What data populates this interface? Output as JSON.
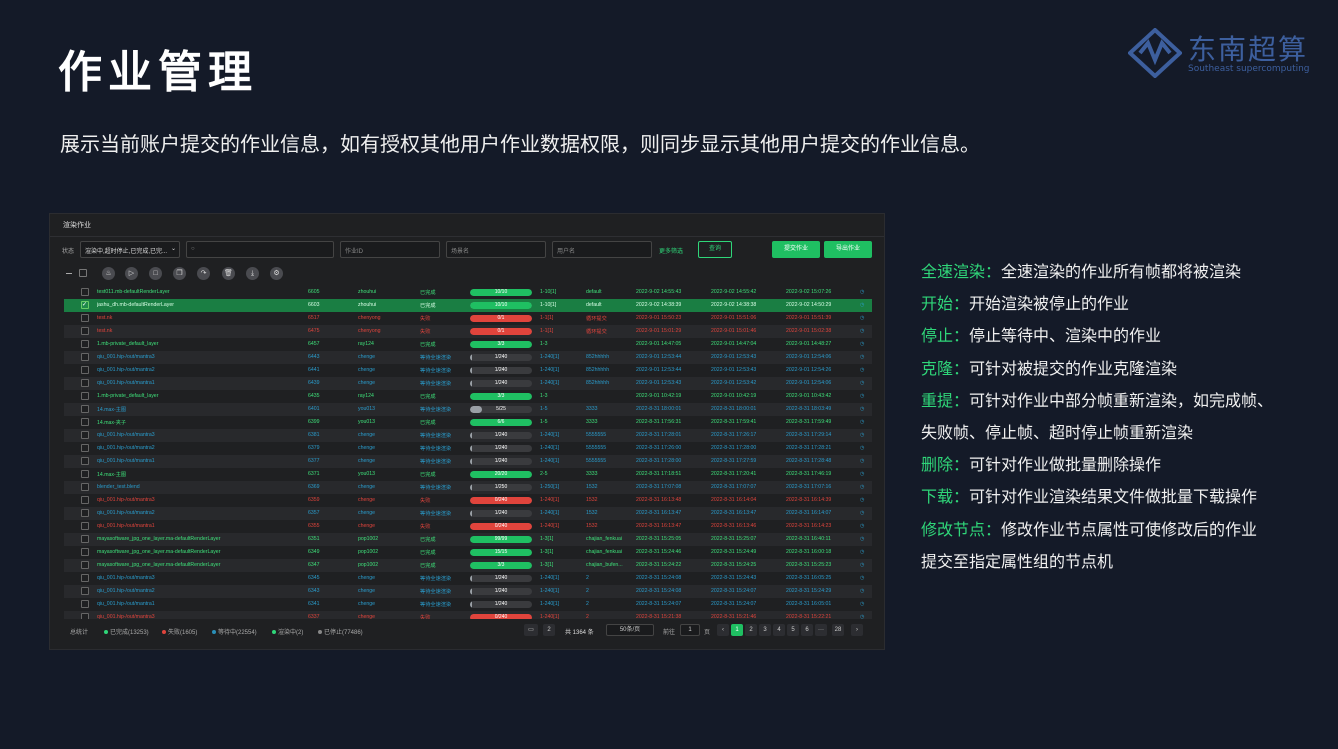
{
  "page_title": "作业管理",
  "subtitle": "展示当前账户提交的作业信息，如有授权其他用户作业数据权限，则同步显示其他用户提交的作业信息。",
  "logo": {
    "cn": "东南超算",
    "en": "Southeast supercomputing"
  },
  "colors": {
    "bg": "#141a28",
    "accent": "#2fd679",
    "success": "#1fbf62",
    "fail": "#e0443c",
    "waiting": "#2a8fb8",
    "logo": "#3d5f9e"
  },
  "app": {
    "title": "渲染作业",
    "filters": {
      "status_label": "状态",
      "status_value": "渲染中,超时停止,已完成,已完...",
      "search_placeholder": "",
      "job_id_placeholder": "作业ID",
      "scene_placeholder": "场景名",
      "user_placeholder": "用户名",
      "more_label": "更多筛选",
      "query_label": "查询",
      "submit_label": "提交作业",
      "export_label": "导出作业"
    },
    "toolbar_icons": [
      "start-icon",
      "play-icon",
      "stop-icon",
      "clone-icon",
      "resubmit-icon",
      "delete-icon",
      "download-icon",
      "settings-icon"
    ],
    "rows": [
      {
        "name": "test011.mb-defaultRenderLayer",
        "id": "6605",
        "user": "zhouhui",
        "status": "已完成",
        "progress": "10/10",
        "pct": 1.0,
        "frames": "1-10[1]",
        "group": "default",
        "submit": "2022-9-02 14:55:43",
        "start": "2022-9-02 14:55:42",
        "end": "2022-9-02 15:07:26",
        "kind": "done",
        "selected": false
      },
      {
        "name": "jashu_dh.mb-defaultRenderLayer",
        "id": "6603",
        "user": "zhouhui",
        "status": "已完成",
        "progress": "10/10",
        "pct": 1.0,
        "frames": "1-10[1]",
        "group": "default",
        "submit": "2022-9-02 14:38:39",
        "start": "2022-9-02 14:38:38",
        "end": "2022-9-02 14:50:29",
        "kind": "done",
        "selected": true
      },
      {
        "name": "test.nk",
        "id": "6517",
        "user": "chenyong",
        "status": "失败",
        "progress": "0/1",
        "pct": 1.0,
        "frames": "1-1[1]",
        "group": "循环提交",
        "submit": "2022-9-01 15:50:23",
        "start": "2022-9-01 15:51:06",
        "end": "2022-9-01 15:51:39",
        "kind": "fail",
        "selected": false
      },
      {
        "name": "test.nk",
        "id": "6475",
        "user": "chenyong",
        "status": "失败",
        "progress": "0/1",
        "pct": 1.0,
        "frames": "1-1[1]",
        "group": "循环提交",
        "submit": "2022-9-01 15:01:29",
        "start": "2022-9-01 15:01:46",
        "end": "2022-9-01 15:02:38",
        "kind": "fail",
        "selected": false
      },
      {
        "name": "1.mb-private_default_layer",
        "id": "6457",
        "user": "ray124",
        "status": "已完成",
        "progress": "3/3",
        "pct": 1.0,
        "frames": "1-3",
        "group": "",
        "submit": "2022-9-01 14:47:05",
        "start": "2022-9-01 14:47:04",
        "end": "2022-9-01 14:48:27",
        "kind": "done",
        "selected": false
      },
      {
        "name": "qiu_001.hip-/out/mantra3",
        "id": "6443",
        "user": "chenge",
        "status": "等待全速渲染",
        "progress": "1/240",
        "pct": 0.01,
        "frames": "1-240[1]",
        "group": "852hhhhh",
        "submit": "2022-9-01 12:53:44",
        "start": "2022-9-01 12:53:43",
        "end": "2022-9-01 12:54:06",
        "kind": "wait",
        "selected": false
      },
      {
        "name": "qiu_001.hip-/out/mantra2",
        "id": "6441",
        "user": "chenge",
        "status": "等待全速渲染",
        "progress": "1/240",
        "pct": 0.01,
        "frames": "1-240[1]",
        "group": "852hhhhh",
        "submit": "2022-9-01 12:53:44",
        "start": "2022-9-01 12:53:43",
        "end": "2022-9-01 12:54:26",
        "kind": "wait",
        "selected": false
      },
      {
        "name": "qiu_001.hip-/out/mantra1",
        "id": "6439",
        "user": "chenge",
        "status": "等待全速渲染",
        "progress": "1/240",
        "pct": 0.01,
        "frames": "1-240[1]",
        "group": "852hhhhh",
        "submit": "2022-9-01 12:53:43",
        "start": "2022-9-01 12:53:42",
        "end": "2022-9-01 12:54:06",
        "kind": "wait",
        "selected": false
      },
      {
        "name": "1.mb-private_default_layer",
        "id": "6435",
        "user": "ray124",
        "status": "已完成",
        "progress": "3/3",
        "pct": 1.0,
        "frames": "1-3",
        "group": "",
        "submit": "2022-9-01 10:42:19",
        "start": "2022-9-01 10:42:19",
        "end": "2022-9-01 10:43:42",
        "kind": "done",
        "selected": false
      },
      {
        "name": "14.max-主图",
        "id": "6401",
        "user": "you013",
        "status": "等待全速渲染",
        "progress": "5/25",
        "pct": 0.2,
        "frames": "1-5",
        "group": "3333",
        "submit": "2022-8-31 18:00:01",
        "start": "2022-8-31 18:00:01",
        "end": "2022-8-31 18:03:49",
        "kind": "wait",
        "selected": false
      },
      {
        "name": "14.max-夹子",
        "id": "6399",
        "user": "you013",
        "status": "已完成",
        "progress": "6/6",
        "pct": 1.0,
        "frames": "1-5",
        "group": "3333",
        "submit": "2022-8-31 17:56:31",
        "start": "2022-8-31 17:59:41",
        "end": "2022-8-31 17:59:49",
        "kind": "done",
        "selected": false
      },
      {
        "name": "qiu_001.hip-/out/mantra3",
        "id": "6381",
        "user": "chenge",
        "status": "等待全速渲染",
        "progress": "1/240",
        "pct": 0.01,
        "frames": "1-240[1]",
        "group": "5555555",
        "submit": "2022-8-31 17:28:01",
        "start": "2022-8-31 17:26:17",
        "end": "2022-8-31 17:29:14",
        "kind": "wait",
        "selected": false
      },
      {
        "name": "qiu_001.hip-/out/mantra2",
        "id": "6379",
        "user": "chenge",
        "status": "等待全速渲染",
        "progress": "1/240",
        "pct": 0.01,
        "frames": "1-240[1]",
        "group": "5555555",
        "submit": "2022-8-31 17:26:00",
        "start": "2022-8-31 17:28:00",
        "end": "2022-8-31 17:28:21",
        "kind": "wait",
        "selected": false
      },
      {
        "name": "qiu_001.hip-/out/mantra1",
        "id": "6377",
        "user": "chenge",
        "status": "等待全速渲染",
        "progress": "1/240",
        "pct": 0.01,
        "frames": "1-240[1]",
        "group": "5555555",
        "submit": "2022-8-31 17:28:00",
        "start": "2022-8-31 17:27:59",
        "end": "2022-8-31 17:28:48",
        "kind": "wait",
        "selected": false
      },
      {
        "name": "14.max-主图",
        "id": "6371",
        "user": "you013",
        "status": "已完成",
        "progress": "20/20",
        "pct": 1.0,
        "frames": "2-5",
        "group": "3333",
        "submit": "2022-8-31 17:18:51",
        "start": "2022-8-31 17:20:41",
        "end": "2022-8-31 17:46:19",
        "kind": "done",
        "selected": false
      },
      {
        "name": "blender_test.blend",
        "id": "6369",
        "user": "chenge",
        "status": "等待全速渲染",
        "progress": "1/250",
        "pct": 0.01,
        "frames": "1-250[1]",
        "group": "1532",
        "submit": "2022-8-31 17:07:08",
        "start": "2022-8-31 17:07:07",
        "end": "2022-8-31 17:07:16",
        "kind": "wait",
        "selected": false
      },
      {
        "name": "qiu_001.hip-/out/mantra3",
        "id": "6359",
        "user": "chenge",
        "status": "失败",
        "progress": "0/240",
        "pct": 1.0,
        "frames": "1-240[1]",
        "group": "1532",
        "submit": "2022-8-31 16:13:48",
        "start": "2022-8-31 16:14:04",
        "end": "2022-8-31 16:14:39",
        "kind": "fail",
        "selected": false
      },
      {
        "name": "qiu_001.hip-/out/mantra2",
        "id": "6357",
        "user": "chenge",
        "status": "等待全速渲染",
        "progress": "1/240",
        "pct": 0.01,
        "frames": "1-240[1]",
        "group": "1532",
        "submit": "2022-8-31 16:13:47",
        "start": "2022-8-31 16:13:47",
        "end": "2022-8-31 16:14:07",
        "kind": "wait",
        "selected": false
      },
      {
        "name": "qiu_001.hip-/out/mantra1",
        "id": "6355",
        "user": "chenge",
        "status": "失败",
        "progress": "0/240",
        "pct": 1.0,
        "frames": "1-240[1]",
        "group": "1532",
        "submit": "2022-8-31 16:13:47",
        "start": "2022-8-31 16:13:46",
        "end": "2022-8-31 16:14:23",
        "kind": "fail",
        "selected": false
      },
      {
        "name": "mayasoftware_jpg_one_layer.ma-defaultRenderLayer",
        "id": "6351",
        "user": "pop1002",
        "status": "已完成",
        "progress": "99/99",
        "pct": 1.0,
        "frames": "1-3[1]",
        "group": "chajian_fenkuai",
        "submit": "2022-8-31 15:25:05",
        "start": "2022-8-31 15:25:07",
        "end": "2022-8-31 16:40:11",
        "kind": "done",
        "selected": false
      },
      {
        "name": "mayasoftware_jpg_one_layer.ma-defaultRenderLayer",
        "id": "6349",
        "user": "pop1002",
        "status": "已完成",
        "progress": "15/15",
        "pct": 1.0,
        "frames": "1-3[1]",
        "group": "chajian_fenkuai",
        "submit": "2022-8-31 15:24:46",
        "start": "2022-8-31 15:24:49",
        "end": "2022-8-31 16:00:18",
        "kind": "done",
        "selected": false
      },
      {
        "name": "mayasoftware_jpg_one_layer.ma-defaultRenderLayer",
        "id": "6347",
        "user": "pop1002",
        "status": "已完成",
        "progress": "3/3",
        "pct": 1.0,
        "frames": "1-3[1]",
        "group": "chajian_bufen...",
        "submit": "2022-8-31 15:24:22",
        "start": "2022-8-31 15:24:25",
        "end": "2022-8-31 15:25:23",
        "kind": "done",
        "selected": false
      },
      {
        "name": "qiu_001.hip-/out/mantra3",
        "id": "6345",
        "user": "chenge",
        "status": "等待全速渲染",
        "progress": "1/240",
        "pct": 0.01,
        "frames": "1-240[1]",
        "group": "2",
        "submit": "2022-8-31 15:24:08",
        "start": "2022-8-31 15:24:43",
        "end": "2022-8-31 16:05:25",
        "kind": "wait",
        "selected": false
      },
      {
        "name": "qiu_001.hip-/out/mantra2",
        "id": "6343",
        "user": "chenge",
        "status": "等待全速渲染",
        "progress": "1/240",
        "pct": 0.01,
        "frames": "1-240[1]",
        "group": "2",
        "submit": "2022-8-31 15:24:08",
        "start": "2022-8-31 15:24:07",
        "end": "2022-8-31 15:24:29",
        "kind": "wait",
        "selected": false
      },
      {
        "name": "qiu_001.hip-/out/mantra1",
        "id": "6341",
        "user": "chenge",
        "status": "等待全速渲染",
        "progress": "1/240",
        "pct": 0.01,
        "frames": "1-240[1]",
        "group": "2",
        "submit": "2022-8-31 15:24:07",
        "start": "2022-8-31 15:24:07",
        "end": "2022-8-31 16:05:01",
        "kind": "wait",
        "selected": false
      },
      {
        "name": "qiu_001.hip-/out/mantra3",
        "id": "6337",
        "user": "chenge",
        "status": "失败",
        "progress": "0/240",
        "pct": 1.0,
        "frames": "1-240[1]",
        "group": "2",
        "submit": "2022-8-31 15:21:38",
        "start": "2022-8-31 15:21:46",
        "end": "2022-8-31 15:22:21",
        "kind": "fail",
        "selected": false
      }
    ],
    "footer": {
      "label": "总统计",
      "stats": [
        {
          "text": "已完成(13253)",
          "color": "#2fd679"
        },
        {
          "text": "失败(1605)",
          "color": "#e0443c"
        },
        {
          "text": "等待中(22554)",
          "color": "#2a8fb8"
        },
        {
          "text": "渲染中(2)",
          "color": "#2fd679"
        },
        {
          "text": "已停止(77486)",
          "color": "#888888"
        }
      ],
      "selected_count": "2",
      "total": "共 1364 条",
      "page_size": "50条/页",
      "goto_label": "前往",
      "goto_value": "1",
      "page_suffix": "页",
      "prev": "‹",
      "pages": [
        "1",
        "2",
        "3",
        "4",
        "5",
        "6",
        "···",
        "28"
      ],
      "next": "›"
    }
  },
  "descriptions": [
    {
      "term": "全速渲染：",
      "text": "全速渲染的作业所有帧都将被渲染"
    },
    {
      "term": "开始：",
      "text": "开始渲染被停止的作业"
    },
    {
      "term": "停止：",
      "text": "停止等待中、渲染中的作业"
    },
    {
      "term": "克隆：",
      "text": "可针对被提交的作业克隆渲染"
    },
    {
      "term": "重提：",
      "text": "可针对作业中部分帧重新渲染，如完成帧、"
    },
    {
      "term": "",
      "text": "失败帧、停止帧、超时停止帧重新渲染"
    },
    {
      "term": "删除：",
      "text": "可针对作业做批量删除操作"
    },
    {
      "term": "下载：",
      "text": "可针对作业渲染结果文件做批量下载操作"
    },
    {
      "term": "修改节点：",
      "text": "修改作业节点属性可使修改后的作业"
    },
    {
      "term": "",
      "text": "提交至指定属性组的节点机"
    }
  ]
}
